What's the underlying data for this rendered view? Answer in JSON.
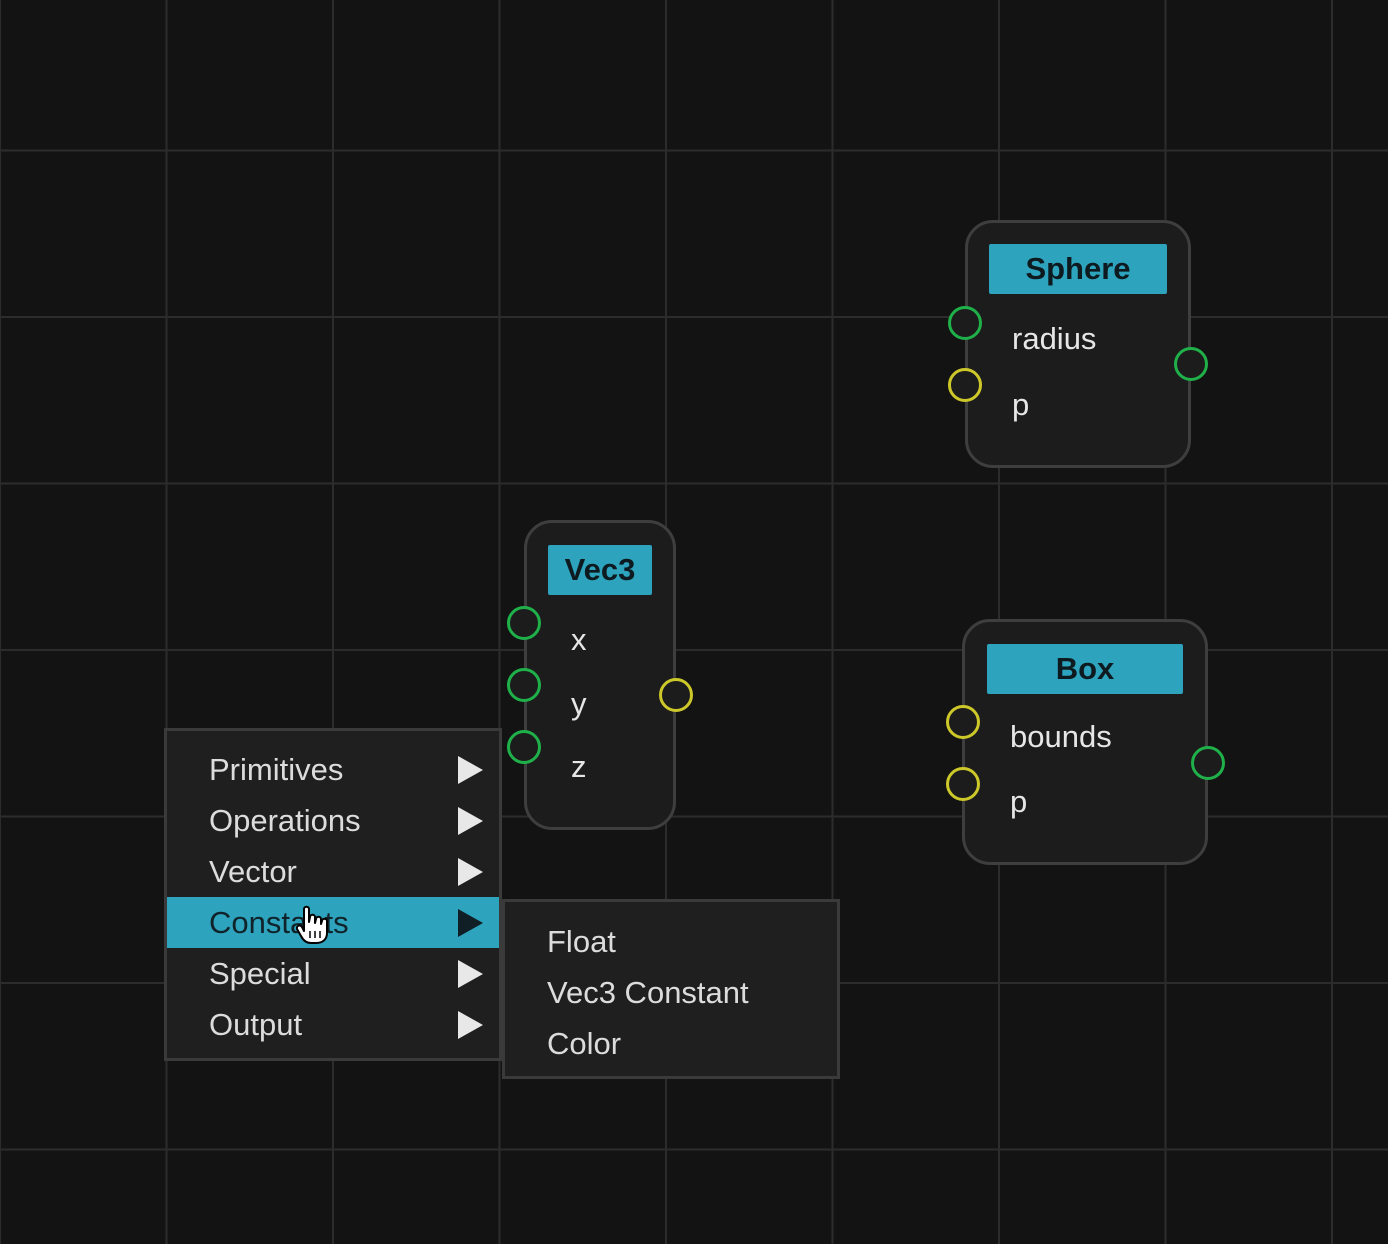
{
  "nodes": {
    "sphere": {
      "title": "Sphere",
      "inputs": [
        "radius",
        "p"
      ]
    },
    "vec3": {
      "title": "Vec3",
      "inputs": [
        "x",
        "y",
        "z"
      ]
    },
    "box": {
      "title": "Box",
      "inputs": [
        "bounds",
        "p"
      ]
    }
  },
  "context_menu": {
    "items": [
      {
        "label": "Primitives"
      },
      {
        "label": "Operations"
      },
      {
        "label": "Vector"
      },
      {
        "label": "Constants",
        "active": true
      },
      {
        "label": "Special"
      },
      {
        "label": "Output"
      }
    ],
    "submenu": {
      "items": [
        "Float",
        "Vec3 Constant",
        "Color"
      ]
    }
  },
  "colors": {
    "accent": "#2ea3bd",
    "port_green": "#1fb04a",
    "port_yellow": "#cdc82a",
    "background": "#131313"
  },
  "icons": {
    "submenu_arrow": "triangle-right-icon",
    "cursor": "hand-pointer-icon"
  }
}
